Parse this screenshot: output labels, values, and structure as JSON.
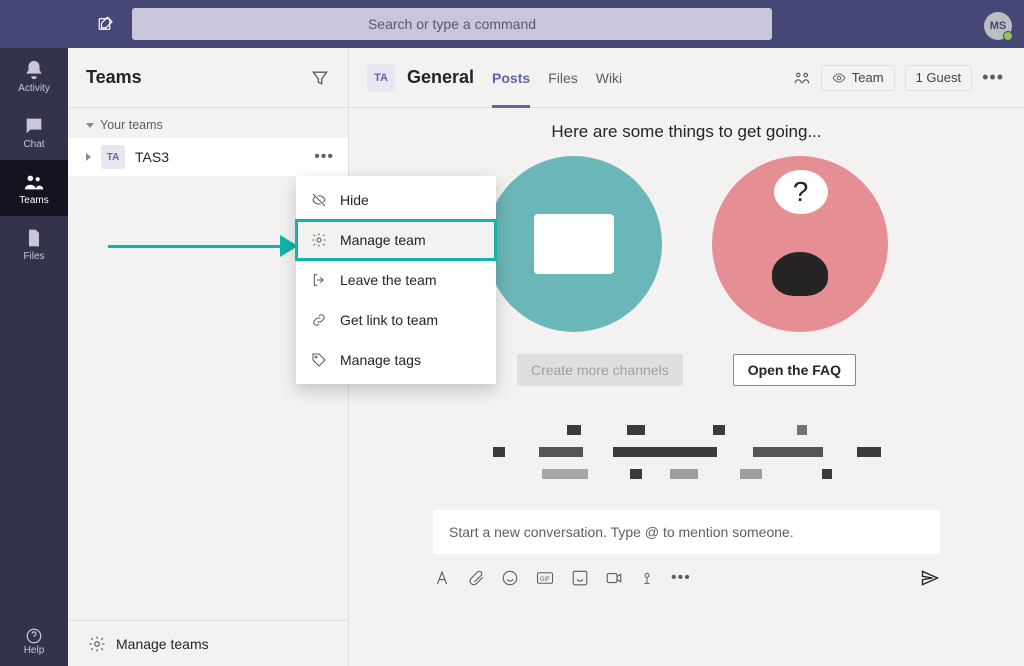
{
  "search": {
    "placeholder": "Search or type a command"
  },
  "avatar": {
    "initials": "MS"
  },
  "rail": {
    "items": [
      {
        "key": "activity",
        "label": "Activity"
      },
      {
        "key": "chat",
        "label": "Chat"
      },
      {
        "key": "teams",
        "label": "Teams"
      },
      {
        "key": "files",
        "label": "Files"
      }
    ],
    "help": "Help"
  },
  "panel": {
    "title": "Teams",
    "group_label": "Your teams",
    "team": {
      "initials": "TA",
      "name": "TAS3"
    },
    "footer": "Manage teams"
  },
  "context_menu": {
    "items": [
      {
        "key": "hide",
        "label": "Hide"
      },
      {
        "key": "manage",
        "label": "Manage team"
      },
      {
        "key": "leave",
        "label": "Leave the team"
      },
      {
        "key": "link",
        "label": "Get link to team"
      },
      {
        "key": "tags",
        "label": "Manage tags"
      }
    ],
    "highlight": "manage"
  },
  "channel": {
    "avatar": "TA",
    "name": "General",
    "tabs": [
      "Posts",
      "Files",
      "Wiki"
    ],
    "active_tab": "Posts",
    "visibility_pill": "Team",
    "guest_pill": "1 Guest"
  },
  "content": {
    "hint": "Here are some things to get going...",
    "left_button": "Create more channels",
    "right_button": "Open the FAQ"
  },
  "compose": {
    "placeholder": "Start a new conversation. Type @ to mention someone."
  }
}
